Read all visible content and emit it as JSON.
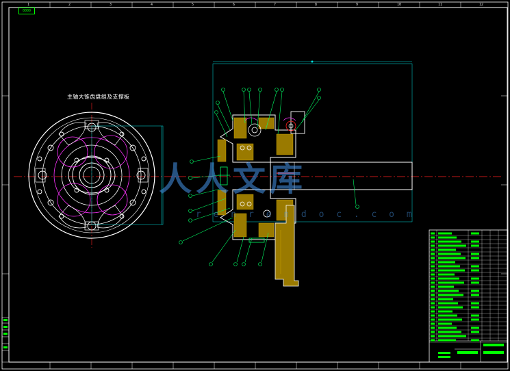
{
  "drawing": {
    "section_title": "主轴大锥齿盘组及支撑板",
    "watermark_cn": "人人文库",
    "watermark_url": "r e n r e n d o c . c o m",
    "corner_tag": "0000",
    "zone_numbers": [
      "1",
      "2",
      "3",
      "4",
      "5",
      "6",
      "7",
      "8",
      "9",
      "10",
      "11",
      "12"
    ],
    "colors": {
      "background": "#000000",
      "outline": "#ffffff",
      "centerline": "#ff2020",
      "dimension": "#00e5e5",
      "leader": "#00ff66",
      "construction": "#ff33ff",
      "hatch": "#c8a000",
      "table_text": "#00ff00"
    }
  }
}
